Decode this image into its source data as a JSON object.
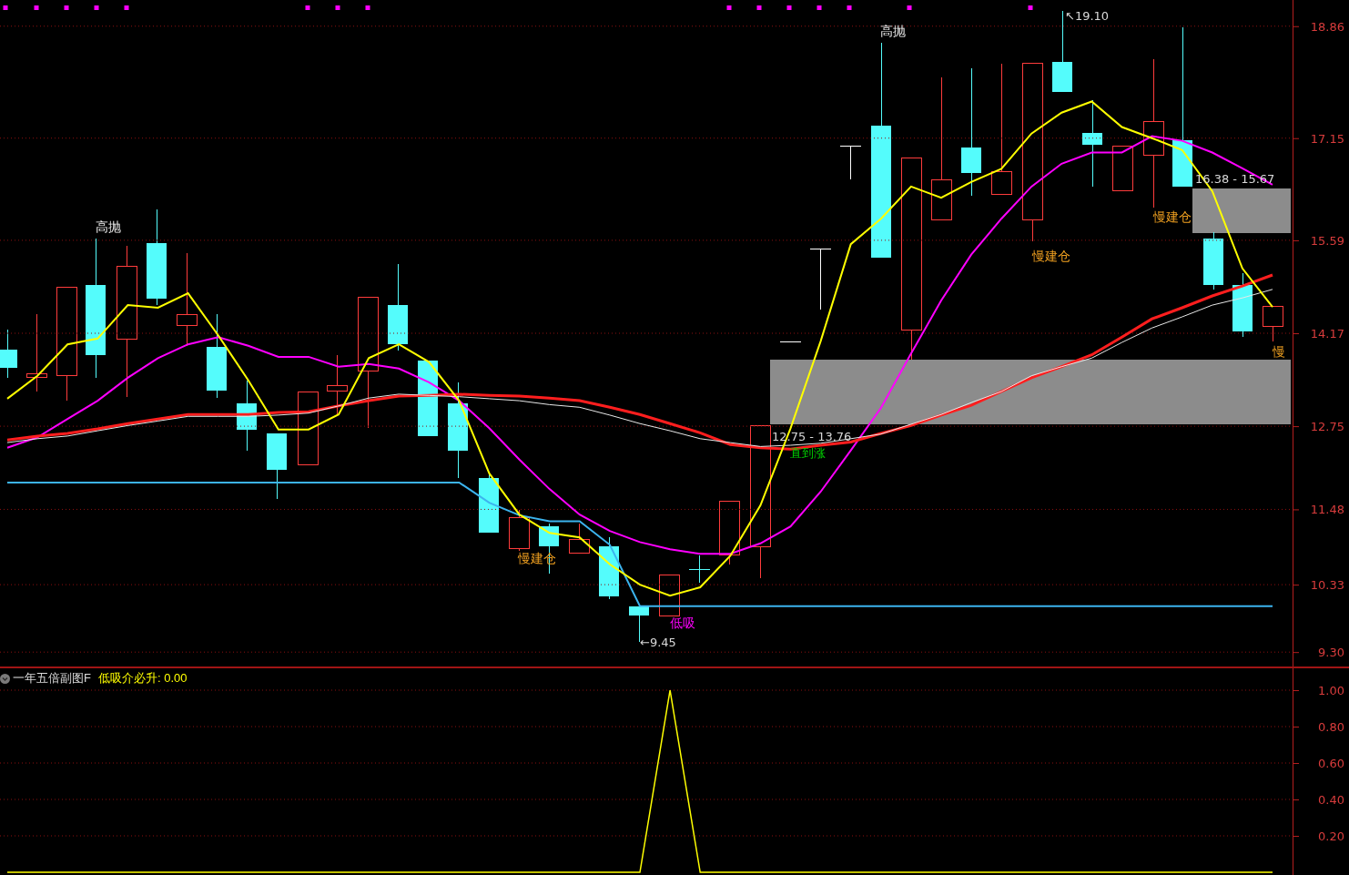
{
  "main_chart": {
    "chart_data": {
      "type": "line",
      "grid": true,
      "ylim": [
        9.08,
        19.26
      ],
      "yticks": [
        {
          "value": 9.3,
          "label": "9.30"
        },
        {
          "value": 10.33,
          "label": "10.33"
        },
        {
          "value": 11.48,
          "label": "11.48"
        },
        {
          "value": 12.75,
          "label": "12.75"
        },
        {
          "value": 14.17,
          "label": "14.17"
        },
        {
          "value": 15.59,
          "label": "15.59"
        },
        {
          "value": 17.15,
          "label": "17.15"
        },
        {
          "value": 18.86,
          "label": "18.86"
        }
      ],
      "series": [
        {
          "color": "#3cb4ee",
          "values": [
            11.89,
            11.89,
            11.89,
            11.89,
            11.89,
            11.89,
            11.89,
            11.89,
            11.89,
            11.89,
            11.89,
            11.89,
            11.89,
            11.89,
            11.89,
            11.89,
            11.58,
            11.39,
            11.3,
            11.3,
            10.94,
            10.0,
            10.0,
            10.0,
            10.0,
            10.0,
            10.0,
            10.0,
            10.0,
            10.0,
            10.0,
            10.0,
            10.0,
            10.0,
            10.0,
            10.0,
            10.0,
            10.0,
            10.0,
            10.0,
            10.0,
            10.0,
            10.0
          ]
        },
        {
          "color": "#ff00ff",
          "values": [
            12.42,
            12.58,
            12.86,
            13.14,
            13.49,
            13.79,
            14.0,
            14.11,
            13.98,
            13.81,
            13.81,
            13.66,
            13.7,
            13.63,
            13.42,
            13.14,
            12.72,
            12.24,
            11.79,
            11.4,
            11.15,
            10.98,
            10.87,
            10.8,
            10.8,
            10.96,
            11.22,
            11.75,
            12.38,
            13.03,
            13.86,
            14.67,
            15.37,
            15.92,
            16.41,
            16.76,
            16.93,
            16.93,
            17.18,
            17.11,
            16.93,
            16.69,
            16.44
          ]
        },
        {
          "color": "#ff1e1e",
          "values": [
            12.54,
            12.6,
            12.64,
            12.71,
            12.79,
            12.86,
            12.93,
            12.93,
            12.93,
            12.96,
            12.97,
            13.06,
            13.14,
            13.21,
            13.22,
            13.24,
            13.22,
            13.21,
            13.18,
            13.14,
            13.04,
            12.93,
            12.79,
            12.65,
            12.47,
            12.42,
            12.4,
            12.46,
            12.51,
            12.64,
            12.76,
            12.92,
            13.07,
            13.28,
            13.49,
            13.66,
            13.84,
            14.11,
            14.39,
            14.56,
            14.74,
            14.89,
            15.06
          ]
        },
        {
          "color": "#e8e8e8",
          "values": [
            12.5,
            12.56,
            12.6,
            12.68,
            12.76,
            12.83,
            12.9,
            12.9,
            12.9,
            12.92,
            12.95,
            13.06,
            13.18,
            13.24,
            13.22,
            13.2,
            13.17,
            13.14,
            13.08,
            13.04,
            12.92,
            12.79,
            12.68,
            12.56,
            12.5,
            12.44,
            12.46,
            12.49,
            12.56,
            12.63,
            12.78,
            12.93,
            13.11,
            13.28,
            13.52,
            13.66,
            13.79,
            14.03,
            14.25,
            14.42,
            14.6,
            14.71,
            14.84
          ]
        },
        {
          "color": "#ffff00",
          "values": [
            13.17,
            13.52,
            14.0,
            14.09,
            14.6,
            14.56,
            14.78,
            14.14,
            13.45,
            12.7,
            12.7,
            12.93,
            13.79,
            14.0,
            13.73,
            13.14,
            12.03,
            11.4,
            11.12,
            11.05,
            10.64,
            10.33,
            10.16,
            10.29,
            10.77,
            11.54,
            12.72,
            14.05,
            15.53,
            15.92,
            16.41,
            16.24,
            16.48,
            16.68,
            17.22,
            17.54,
            17.71,
            17.32,
            17.15,
            16.97,
            16.34,
            15.16,
            14.57
          ]
        }
      ]
    },
    "annotations": [
      {
        "kind": "note",
        "text": "↖19.10"
      },
      {
        "kind": "sell",
        "text": "高抛"
      },
      {
        "kind": "note",
        "text": "16.38 - 15.67"
      },
      {
        "kind": "build",
        "text": "慢建仓"
      },
      {
        "kind": "sell",
        "text": "高抛"
      },
      {
        "kind": "build",
        "text": "慢建仓"
      },
      {
        "kind": "build",
        "text": "慢"
      },
      {
        "kind": "note",
        "text": "12.75 - 13.76"
      },
      {
        "kind": "hold",
        "text": "直到涨"
      },
      {
        "kind": "build",
        "text": "慢建仓"
      },
      {
        "kind": "buy",
        "text": "低吸"
      },
      {
        "kind": "note",
        "text": "←9.45"
      }
    ]
  },
  "indicator_panel": {
    "title": "一年五倍副图F",
    "reading": "低吸介必升: 0.00",
    "chart_data": {
      "type": "line",
      "grid": true,
      "values": [
        0,
        0,
        0,
        0,
        0,
        0,
        0,
        0,
        0,
        0,
        0,
        0,
        0,
        0,
        0,
        0,
        0,
        0,
        0,
        0,
        0,
        0,
        1,
        0,
        0,
        0,
        0,
        0,
        0,
        0,
        0,
        0,
        0,
        0,
        0,
        0,
        0,
        0,
        0,
        0,
        0,
        0,
        0
      ],
      "ylim": [
        0,
        1
      ],
      "yticks": [
        {
          "value": 0.2,
          "label": "0.20"
        },
        {
          "value": 0.4,
          "label": "0.40"
        },
        {
          "value": 0.6,
          "label": "0.60"
        },
        {
          "value": 0.8,
          "label": "0.80"
        },
        {
          "value": 1,
          "label": "1.00"
        }
      ]
    }
  }
}
